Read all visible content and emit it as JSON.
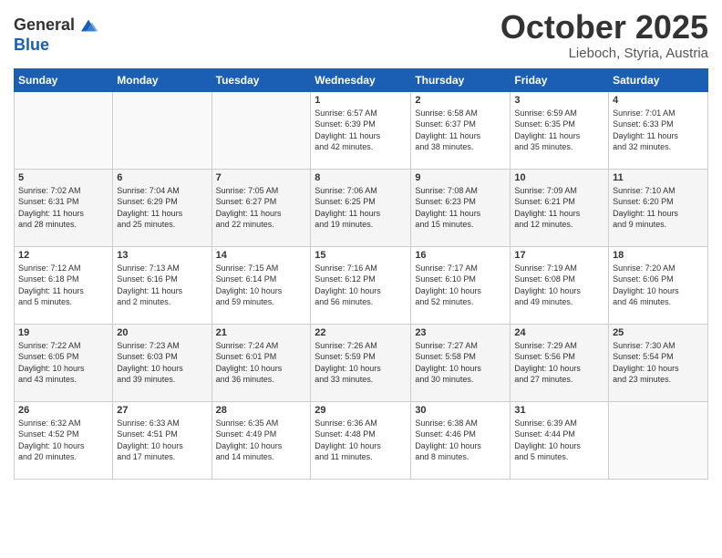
{
  "header": {
    "logo_general": "General",
    "logo_blue": "Blue",
    "month_title": "October 2025",
    "location": "Lieboch, Styria, Austria"
  },
  "weekdays": [
    "Sunday",
    "Monday",
    "Tuesday",
    "Wednesday",
    "Thursday",
    "Friday",
    "Saturday"
  ],
  "weeks": [
    [
      {
        "day": "",
        "info": ""
      },
      {
        "day": "",
        "info": ""
      },
      {
        "day": "",
        "info": ""
      },
      {
        "day": "1",
        "info": "Sunrise: 6:57 AM\nSunset: 6:39 PM\nDaylight: 11 hours\nand 42 minutes."
      },
      {
        "day": "2",
        "info": "Sunrise: 6:58 AM\nSunset: 6:37 PM\nDaylight: 11 hours\nand 38 minutes."
      },
      {
        "day": "3",
        "info": "Sunrise: 6:59 AM\nSunset: 6:35 PM\nDaylight: 11 hours\nand 35 minutes."
      },
      {
        "day": "4",
        "info": "Sunrise: 7:01 AM\nSunset: 6:33 PM\nDaylight: 11 hours\nand 32 minutes."
      }
    ],
    [
      {
        "day": "5",
        "info": "Sunrise: 7:02 AM\nSunset: 6:31 PM\nDaylight: 11 hours\nand 28 minutes."
      },
      {
        "day": "6",
        "info": "Sunrise: 7:04 AM\nSunset: 6:29 PM\nDaylight: 11 hours\nand 25 minutes."
      },
      {
        "day": "7",
        "info": "Sunrise: 7:05 AM\nSunset: 6:27 PM\nDaylight: 11 hours\nand 22 minutes."
      },
      {
        "day": "8",
        "info": "Sunrise: 7:06 AM\nSunset: 6:25 PM\nDaylight: 11 hours\nand 19 minutes."
      },
      {
        "day": "9",
        "info": "Sunrise: 7:08 AM\nSunset: 6:23 PM\nDaylight: 11 hours\nand 15 minutes."
      },
      {
        "day": "10",
        "info": "Sunrise: 7:09 AM\nSunset: 6:21 PM\nDaylight: 11 hours\nand 12 minutes."
      },
      {
        "day": "11",
        "info": "Sunrise: 7:10 AM\nSunset: 6:20 PM\nDaylight: 11 hours\nand 9 minutes."
      }
    ],
    [
      {
        "day": "12",
        "info": "Sunrise: 7:12 AM\nSunset: 6:18 PM\nDaylight: 11 hours\nand 5 minutes."
      },
      {
        "day": "13",
        "info": "Sunrise: 7:13 AM\nSunset: 6:16 PM\nDaylight: 11 hours\nand 2 minutes."
      },
      {
        "day": "14",
        "info": "Sunrise: 7:15 AM\nSunset: 6:14 PM\nDaylight: 10 hours\nand 59 minutes."
      },
      {
        "day": "15",
        "info": "Sunrise: 7:16 AM\nSunset: 6:12 PM\nDaylight: 10 hours\nand 56 minutes."
      },
      {
        "day": "16",
        "info": "Sunrise: 7:17 AM\nSunset: 6:10 PM\nDaylight: 10 hours\nand 52 minutes."
      },
      {
        "day": "17",
        "info": "Sunrise: 7:19 AM\nSunset: 6:08 PM\nDaylight: 10 hours\nand 49 minutes."
      },
      {
        "day": "18",
        "info": "Sunrise: 7:20 AM\nSunset: 6:06 PM\nDaylight: 10 hours\nand 46 minutes."
      }
    ],
    [
      {
        "day": "19",
        "info": "Sunrise: 7:22 AM\nSunset: 6:05 PM\nDaylight: 10 hours\nand 43 minutes."
      },
      {
        "day": "20",
        "info": "Sunrise: 7:23 AM\nSunset: 6:03 PM\nDaylight: 10 hours\nand 39 minutes."
      },
      {
        "day": "21",
        "info": "Sunrise: 7:24 AM\nSunset: 6:01 PM\nDaylight: 10 hours\nand 36 minutes."
      },
      {
        "day": "22",
        "info": "Sunrise: 7:26 AM\nSunset: 5:59 PM\nDaylight: 10 hours\nand 33 minutes."
      },
      {
        "day": "23",
        "info": "Sunrise: 7:27 AM\nSunset: 5:58 PM\nDaylight: 10 hours\nand 30 minutes."
      },
      {
        "day": "24",
        "info": "Sunrise: 7:29 AM\nSunset: 5:56 PM\nDaylight: 10 hours\nand 27 minutes."
      },
      {
        "day": "25",
        "info": "Sunrise: 7:30 AM\nSunset: 5:54 PM\nDaylight: 10 hours\nand 23 minutes."
      }
    ],
    [
      {
        "day": "26",
        "info": "Sunrise: 6:32 AM\nSunset: 4:52 PM\nDaylight: 10 hours\nand 20 minutes."
      },
      {
        "day": "27",
        "info": "Sunrise: 6:33 AM\nSunset: 4:51 PM\nDaylight: 10 hours\nand 17 minutes."
      },
      {
        "day": "28",
        "info": "Sunrise: 6:35 AM\nSunset: 4:49 PM\nDaylight: 10 hours\nand 14 minutes."
      },
      {
        "day": "29",
        "info": "Sunrise: 6:36 AM\nSunset: 4:48 PM\nDaylight: 10 hours\nand 11 minutes."
      },
      {
        "day": "30",
        "info": "Sunrise: 6:38 AM\nSunset: 4:46 PM\nDaylight: 10 hours\nand 8 minutes."
      },
      {
        "day": "31",
        "info": "Sunrise: 6:39 AM\nSunset: 4:44 PM\nDaylight: 10 hours\nand 5 minutes."
      },
      {
        "day": "",
        "info": ""
      }
    ]
  ]
}
